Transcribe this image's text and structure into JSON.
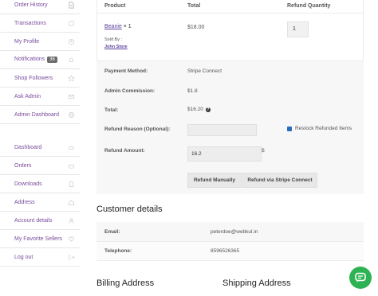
{
  "sidebar": {
    "items": [
      {
        "label": "Order History",
        "icon": "document-icon"
      },
      {
        "label": "Transactions",
        "icon": "coin-icon"
      },
      {
        "label": "My Profile",
        "icon": "profile-icon"
      },
      {
        "label": "Notifications",
        "badge": "36",
        "icon": "bell-icon"
      },
      {
        "label": "Shop Followers",
        "icon": "star-icon"
      },
      {
        "label": "Ask Admin",
        "icon": "mail-icon"
      },
      {
        "label": "Admin Dashboard",
        "icon": "globe-icon"
      },
      {
        "label": "Dashboard",
        "icon": "dashboard-icon"
      },
      {
        "label": "Orders",
        "icon": "basket-icon"
      },
      {
        "label": "Downloads",
        "icon": "download-icon"
      },
      {
        "label": "Address",
        "icon": "home-icon"
      },
      {
        "label": "Account details",
        "icon": "user-icon"
      },
      {
        "label": "My Favorite Sellers",
        "icon": "heart-icon"
      },
      {
        "label": "Log out",
        "icon": "logout-icon"
      }
    ]
  },
  "table": {
    "headers": {
      "product": "Product",
      "total": "Total",
      "refund_qty": "Refund Quantity"
    },
    "product": {
      "name": "Beanie",
      "qty_suffix": " × 1",
      "sold_by": "Sold By :",
      "vendor": "John Store",
      "price": "$18.00",
      "refund_qty": "1"
    }
  },
  "summary": {
    "payment_method_label": "Payment Method:",
    "payment_method_value": "Stripe Connect",
    "admin_commission_label": "Admin Commission:",
    "admin_commission_value": "$1.8",
    "total_label": "Total:",
    "total_value": "$16.20",
    "refund_reason_label": "Refund Reason (Optional):",
    "refund_reason_value": "",
    "restock_label": "Restock Refunded Items",
    "refund_amount_label": "Refund Amount:",
    "refund_amount_value": "16.2",
    "currency": "$",
    "refund_manually": "Refund Manually",
    "refund_stripe": "Refund via Stripe Connect"
  },
  "customer": {
    "heading": "Customer details",
    "email_label": "Email:",
    "email_value": "peterdoe@webkul.in",
    "phone_label": "Telephone:",
    "phone_value": "8596526365"
  },
  "billing_heading": "Billing Address",
  "shipping_heading": "Shipping Address",
  "colors": {
    "accent": "#7a4b9c",
    "chat": "#2eb354",
    "checkbox": "#2a6ebb"
  }
}
